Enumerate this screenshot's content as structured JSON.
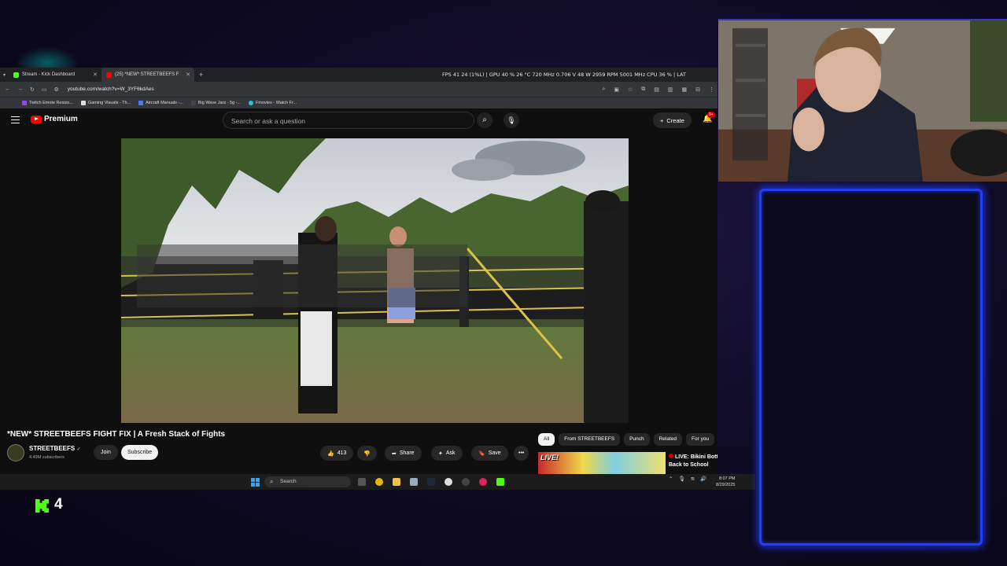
{
  "browser": {
    "tabs": [
      {
        "label": "Stream - Kick Dashboard",
        "favicon_color": "#53fc18"
      },
      {
        "label": "(25) *NEW* STREETBEEFS F",
        "favicon_color": "#ff0000"
      }
    ],
    "perf_overlay": "FPS  41   24 (1%L)  | GPU 40 % 26 °C 720 MHz 0.706 V 48 W 2959 RPM 5001 MHz  CPU 36 %  |  LAT",
    "url": "youtube.com/watch?v=W_3YF6kdAes",
    "bookmarks": [
      "Twitch Emote Resize...",
      "Gaming Visuals - Th...",
      "Aircraft Manuals -...",
      "Big Wave Jars - 5g -...",
      "Fmovies - Watch Fr..."
    ]
  },
  "youtube": {
    "brand": "Premium",
    "search_placeholder": "Search or ask a question",
    "create_label": "Create",
    "notif_count": "9+",
    "video_title": "*NEW* STREETBEEFS FIGHT FIX | A Fresh Stack of Fights",
    "channel": {
      "name": "STREETBEEFS",
      "subs": "4.49M subscribers"
    },
    "join_label": "Join",
    "subscribe_label": "Subscribe",
    "actions": {
      "likes": "413",
      "share": "Share",
      "ask": "Ask",
      "save": "Save"
    },
    "chips": [
      "All",
      "From STREETBEEFS",
      "Punch",
      "Related",
      "For you"
    ],
    "recommended": {
      "badge": "LIVE!",
      "title": "LIVE: Bikini Bottom Back to School"
    }
  },
  "taskbar": {
    "search_label": "Search",
    "time": "8:07 PM",
    "date": "8/29/2025"
  },
  "stream_overlay": {
    "viewer_count": "4",
    "accent_color": "#1f3ff0",
    "kick_color": "#53fc18"
  }
}
